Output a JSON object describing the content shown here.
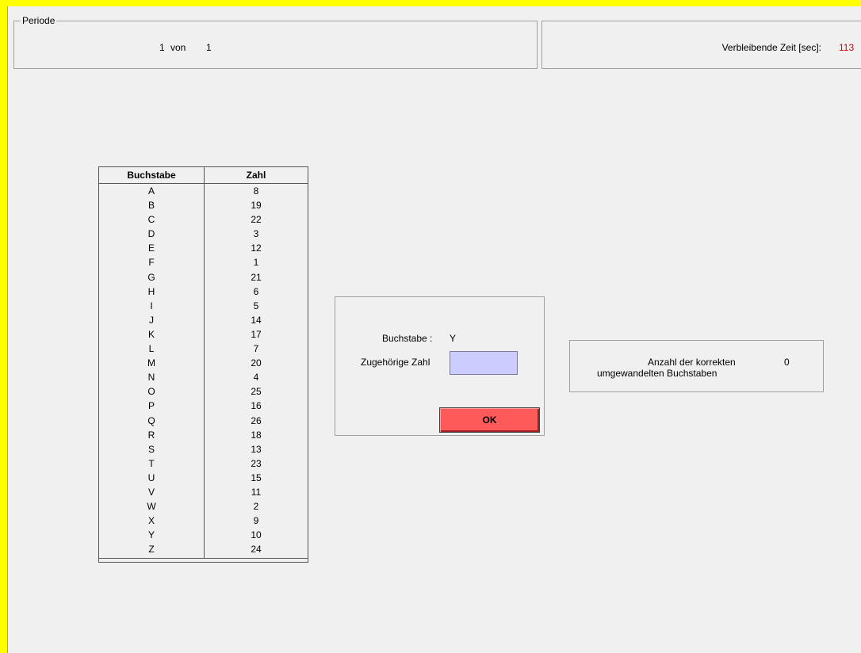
{
  "period": {
    "legend": "Periode",
    "current": "1",
    "of_label": "von",
    "total": "1"
  },
  "time": {
    "label": "Verbleibende Zeit [sec]:",
    "value": "113"
  },
  "table": {
    "headers": [
      "Buchstabe",
      "Zahl"
    ],
    "rows": [
      [
        "A",
        "8"
      ],
      [
        "B",
        "19"
      ],
      [
        "C",
        "22"
      ],
      [
        "D",
        "3"
      ],
      [
        "E",
        "12"
      ],
      [
        "F",
        "1"
      ],
      [
        "G",
        "21"
      ],
      [
        "H",
        "6"
      ],
      [
        "I",
        "5"
      ],
      [
        "J",
        "14"
      ],
      [
        "K",
        "17"
      ],
      [
        "L",
        "7"
      ],
      [
        "M",
        "20"
      ],
      [
        "N",
        "4"
      ],
      [
        "O",
        "25"
      ],
      [
        "P",
        "16"
      ],
      [
        "Q",
        "26"
      ],
      [
        "R",
        "18"
      ],
      [
        "S",
        "13"
      ],
      [
        "T",
        "23"
      ],
      [
        "U",
        "15"
      ],
      [
        "V",
        "11"
      ],
      [
        "W",
        "2"
      ],
      [
        "X",
        "9"
      ],
      [
        "Y",
        "10"
      ],
      [
        "Z",
        "24"
      ]
    ]
  },
  "entry": {
    "letter_label": "Buchstabe :",
    "letter_value": "Y",
    "number_label": "Zugehörige Zahl",
    "number_value": "",
    "ok_label": "OK",
    "ok_color": "#ff5a5a",
    "input_color": "#ccccff"
  },
  "score": {
    "label_line1": "Anzahl der korrekten",
    "label_line2": "umgewandelten Buchstaben",
    "value": "0"
  },
  "colors": {
    "frame": "#ffff00",
    "time_value": "#e00000"
  }
}
